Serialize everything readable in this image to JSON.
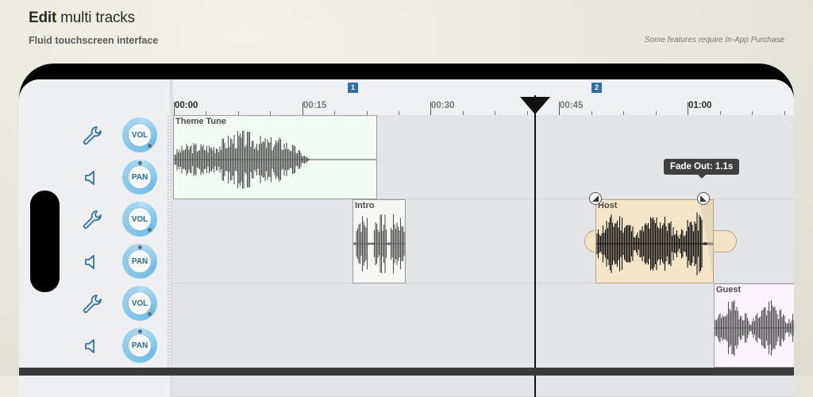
{
  "promo": {
    "title_bold": "Edit",
    "title_rest": " multi tracks",
    "subtitle": "Fluid touchscreen interface",
    "notice": "Some features require In-App Purchase"
  },
  "markers": [
    "1",
    "2"
  ],
  "ruler": {
    "labels": [
      "00:00",
      "00:15",
      "00:30",
      "00:45",
      "01:00"
    ]
  },
  "controls": [
    {
      "icon": "wrench-icon",
      "knob": "VOL"
    },
    {
      "icon": "speaker-icon",
      "knob": "PAN"
    },
    {
      "icon": "wrench-icon",
      "knob": "VOL"
    },
    {
      "icon": "speaker-icon",
      "knob": "PAN"
    },
    {
      "icon": "wrench-icon",
      "knob": "VOL"
    },
    {
      "icon": "speaker-icon",
      "knob": "PAN"
    }
  ],
  "clips": {
    "theme_tune": "Theme Tune",
    "intro": "Intro",
    "host": "Host",
    "guest": "Guest"
  },
  "tooltip": "Fade Out: 1.1s",
  "colors": {
    "accent": "#2c6fa0",
    "clip_green": "#f1fbf4",
    "clip_selected": "#f3e6c8",
    "clip_pink": "#fbf3fb",
    "waveform": "#555555"
  }
}
